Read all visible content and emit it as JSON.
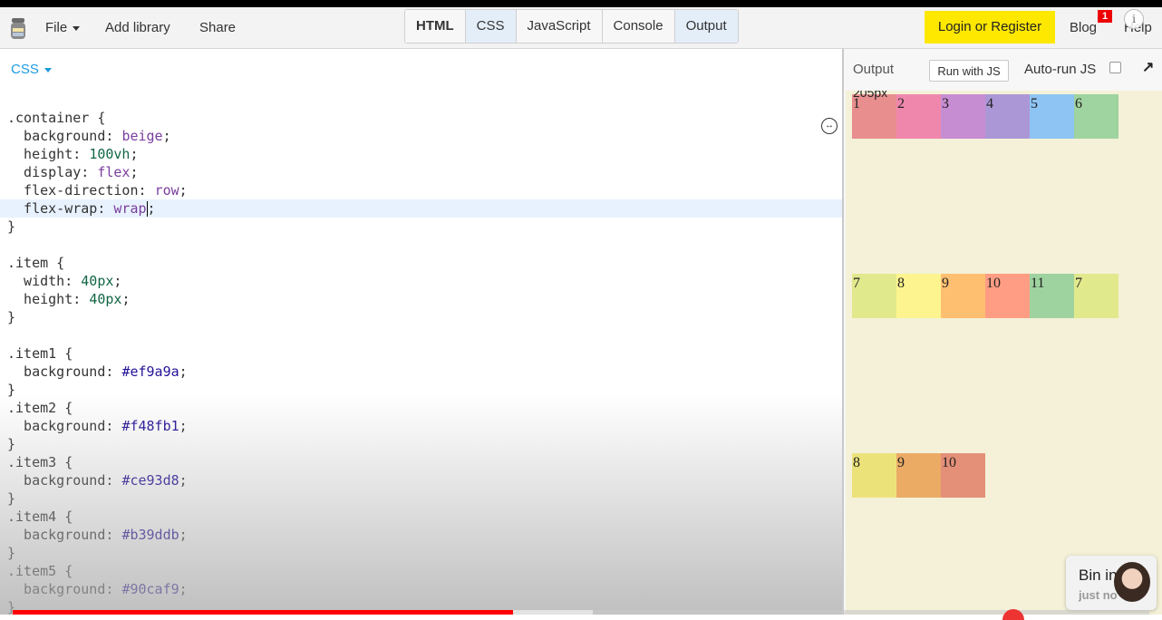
{
  "header": {
    "menu": {
      "file": "File",
      "add_library": "Add library",
      "share": "Share"
    },
    "tabs": [
      {
        "label": "HTML",
        "active": false
      },
      {
        "label": "CSS",
        "active": true
      },
      {
        "label": "JavaScript",
        "active": false
      },
      {
        "label": "Console",
        "active": false
      },
      {
        "label": "Output",
        "active": true
      }
    ],
    "login_label": "Login or Register",
    "blog_label": "Blog",
    "blog_badge": "1",
    "help_label": "Help",
    "info_icon_glyph": "i"
  },
  "editor": {
    "pane_label": "CSS",
    "lines": [
      ".container {",
      "  background: beige;",
      "  height: 100vh;",
      "  display: flex;",
      "  flex-direction: row;",
      "  flex-wrap: wrap;",
      "}",
      "",
      ".item {",
      "  width: 40px;",
      "  height: 40px;",
      "}",
      "",
      ".item1 {",
      "  background: #ef9a9a;",
      "}",
      ".item2 {",
      "  background: #f48fb1;",
      "}",
      ".item3 {",
      "  background: #ce93d8;",
      "}",
      ".item4 {",
      "  background: #b39ddb;",
      "}",
      ".item5 {",
      "  background: #90caf9;",
      "}"
    ],
    "highlighted_line": 5,
    "resize_icon_glyph": "↔"
  },
  "output": {
    "title": "Output",
    "run_label": "Run with JS",
    "autorun_label": "Auto-run JS",
    "autorun_checked": false,
    "expand_icon_glyph": "↗",
    "width_label": "205px",
    "rows": [
      [
        {
          "label": "1",
          "color": "#e88e8e"
        },
        {
          "label": "2",
          "color": "#ef87ad"
        },
        {
          "label": "3",
          "color": "#c78dd2"
        },
        {
          "label": "4",
          "color": "#ab97d6"
        },
        {
          "label": "5",
          "color": "#8ec4f4"
        },
        {
          "label": "6",
          "color": "#9fd39f"
        }
      ],
      [
        {
          "label": "7",
          "color": "#e1e98d"
        },
        {
          "label": "8",
          "color": "#fdf48f"
        },
        {
          "label": "9",
          "color": "#ffbf70"
        },
        {
          "label": "10",
          "color": "#ff9d84"
        },
        {
          "label": "11",
          "color": "#9ed3a0"
        },
        {
          "label": "7",
          "color": "#e1e98d"
        }
      ],
      [
        {
          "label": "8",
          "color": "#ece27a"
        },
        {
          "label": "9",
          "color": "#ebab65"
        },
        {
          "label": "10",
          "color": "#e48f78"
        }
      ]
    ]
  },
  "overlay": {
    "title": "Bin in",
    "subtitle": "just no"
  },
  "video_progress": 0.44
}
